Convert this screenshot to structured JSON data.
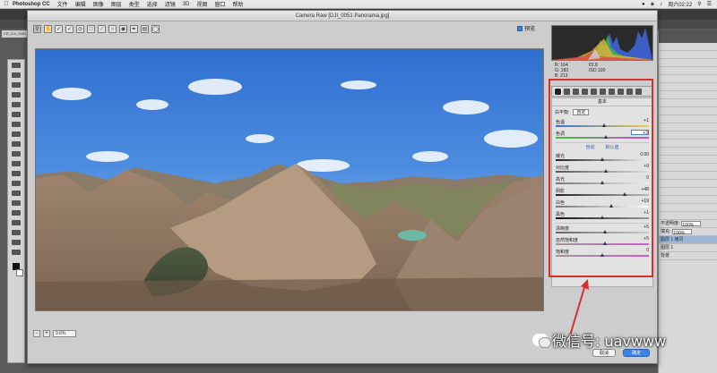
{
  "menubar": {
    "apple": "",
    "app_name": "Photoshop CC",
    "items": [
      "文件",
      "编辑",
      "图像",
      "图层",
      "类型",
      "选择",
      "滤镜",
      "3D",
      "视图",
      "窗口",
      "帮助"
    ],
    "clock": "周六02:22"
  },
  "doc_tab": "CR_DJI_0051",
  "camera_raw": {
    "title": "Camera Raw [DJI_0051 Panorama.jpg]",
    "preview_label": "预览",
    "zoom": "9.6%",
    "histogram_readout": {
      "r_label": "R:",
      "r": "164",
      "g_label": "G:",
      "g": "183",
      "b_label": "B:",
      "b": "213",
      "aperture": "f/2.8",
      "iso": "ISO 100"
    },
    "panel_title": "基本",
    "white_balance": {
      "label": "白平衡:",
      "value": "自定"
    },
    "auto_label": "自动",
    "default_label": "默认值",
    "sliders_wb": [
      {
        "label": "色温",
        "value": "+1",
        "position": 0.52
      },
      {
        "label": "色调",
        "value": "+3",
        "position": 0.54,
        "boxed": true
      }
    ],
    "sliders_tone": [
      {
        "label": "曝光",
        "value": "0.00",
        "position": 0.5
      },
      {
        "label": "对比度",
        "value": "+9",
        "position": 0.54
      },
      {
        "label": "高光",
        "value": "0",
        "position": 0.5
      },
      {
        "label": "阴影",
        "value": "+48",
        "position": 0.74
      },
      {
        "label": "白色",
        "value": "+19",
        "position": 0.6
      },
      {
        "label": "黑色",
        "value": "+1",
        "position": 0.5
      }
    ],
    "sliders_presence": [
      {
        "label": "清晰度",
        "value": "+5",
        "position": 0.53
      },
      {
        "label": "自然饱和度",
        "value": "+5",
        "position": 0.53
      },
      {
        "label": "饱和度",
        "value": "0",
        "position": 0.5
      }
    ],
    "cancel_label": "取消",
    "ok_label": "确定"
  },
  "right_panel": {
    "rows": [
      "不透明度:",
      "填充:",
      "背景",
      "图层 1 拷贝",
      "图层 1"
    ],
    "opacity": "100%",
    "fill": "100%"
  },
  "watermark": "微信号: uavwww",
  "colors": {
    "annotation": "#d8302b",
    "accent": "#3d82e0"
  }
}
